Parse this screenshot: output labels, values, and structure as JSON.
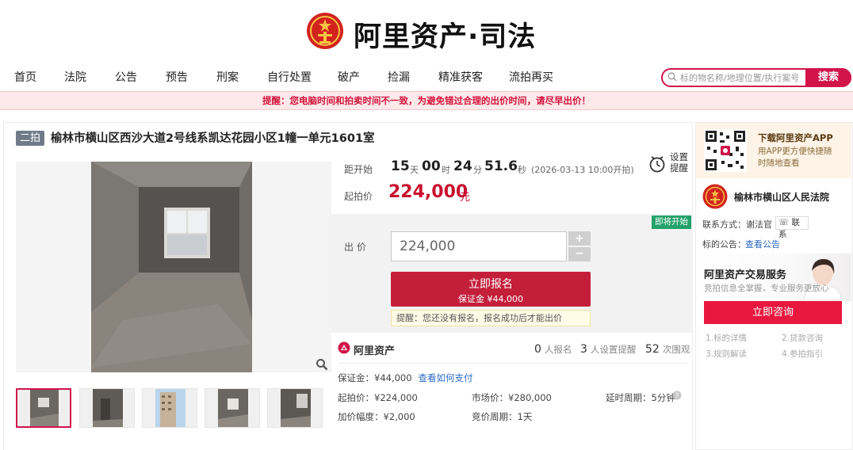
{
  "brand": {
    "title": "阿里资产·司法",
    "emblem_icon": "court-emblem-icon",
    "accent_color": "#d2144a"
  },
  "nav": [
    "首页",
    "法院",
    "公告",
    "预告",
    "刑案",
    "自行处置",
    "破产",
    "捡漏",
    "精准获客",
    "流拍再买"
  ],
  "search": {
    "placeholder": "标的物名称/地理位置/执行案号",
    "button": "搜索",
    "icon": "search-icon"
  },
  "warning": "提醒：您电脑时间和拍卖时间不一致，为避免错过合理的出价时间，请尽早出价！",
  "item": {
    "round_badge": "二拍",
    "title": "榆林市横山区西沙大道2号线系凯达花园小区1幢一单元1601室"
  },
  "countdown": {
    "label": "距开始",
    "days": "15",
    "days_unit": "天",
    "hours": "00",
    "hours_unit": "时",
    "minutes": "24",
    "minutes_unit": "分",
    "seconds": "51.6",
    "seconds_unit": "秒",
    "start_time": "(2026-03-13 10:00开拍)",
    "reminder_label": "设置提醒"
  },
  "start_price": {
    "label": "起拍价",
    "value": "224,000",
    "unit": "元"
  },
  "bid": {
    "soon_tag": "即将开始",
    "label": "出价",
    "value": "224,000",
    "plus": "+",
    "minus": "−",
    "register_button": "立即报名",
    "deposit_line": "保证金 ¥44,000",
    "notice": "提醒：您还没有报名，报名成功后才能出价"
  },
  "stats": {
    "brand": "阿里资产",
    "registered_count": "0",
    "registered_label": "人报名",
    "reminders_count": "3",
    "reminders_label": "人设置提醒",
    "views_count": "52",
    "views_label": "次围观"
  },
  "details": {
    "deposit": "保证金：¥44,000",
    "deposit_link": "查看如何支付",
    "start_price": "起拍价：¥224,000",
    "market_price": "市场价：¥280,000",
    "delay_period": "延时周期：5分钟",
    "increment": "加价幅度：¥2,000",
    "auction_period": "竞价周期：1天"
  },
  "sidebar": {
    "app_title": "下载阿里资产APP",
    "app_desc": "用APP更方便快捷随时随地查看",
    "court_name": "榆林市横山区人民法院",
    "contact": "联系方式：谢法官",
    "contact_button": "联系",
    "notice_label": "标的公告：",
    "notice_link": "查看公告",
    "service_title": "阿里资产交易服务",
    "service_desc": "竞拍信息全掌握，专业服务更放心",
    "consult_button": "立即咨询",
    "guides": [
      "1.标的详情",
      "2.贷款咨询",
      "3.规则解读",
      "4.参拍指引"
    ]
  }
}
